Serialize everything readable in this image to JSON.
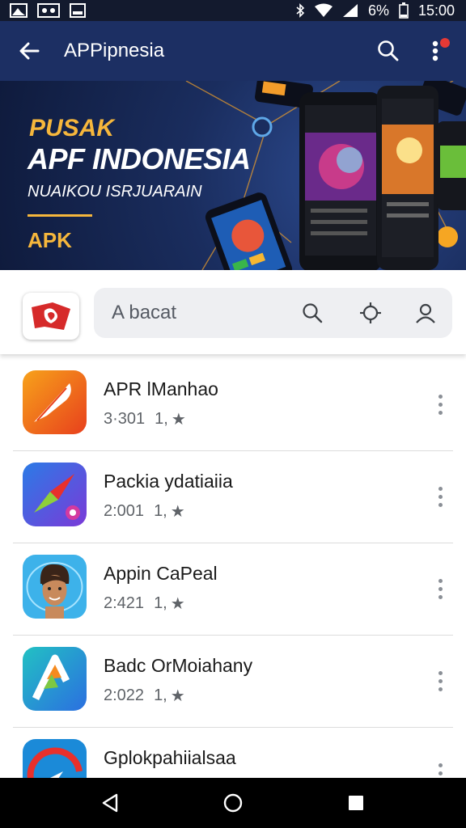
{
  "status_bar": {
    "battery": "6%",
    "time": "15:00"
  },
  "app_bar": {
    "title": "APPipnesia"
  },
  "banner": {
    "kicker": "PUSAK",
    "title": "APF INDONESIA",
    "subtitle": "NUAIKOU ISRJUARAIN",
    "tag": "APK"
  },
  "search": {
    "placeholder": "A bacat"
  },
  "apps": [
    {
      "name": "APR lManhao",
      "size": "3·301",
      "rating": "1,"
    },
    {
      "name": "Packia ydatiaiia",
      "size": "2:001",
      "rating": "1,"
    },
    {
      "name": "Appin CaPeal",
      "size": "2:421",
      "rating": "1,"
    },
    {
      "name": "Badc OrMoiahany",
      "size": "2:022",
      "rating": "1,"
    },
    {
      "name": "Gplokpahiialsaa",
      "size": "",
      "rating": ""
    }
  ],
  "colors": {
    "app_bar": "#1c2f63",
    "accent": "#f6b73c",
    "status_bar": "#131a2e"
  }
}
